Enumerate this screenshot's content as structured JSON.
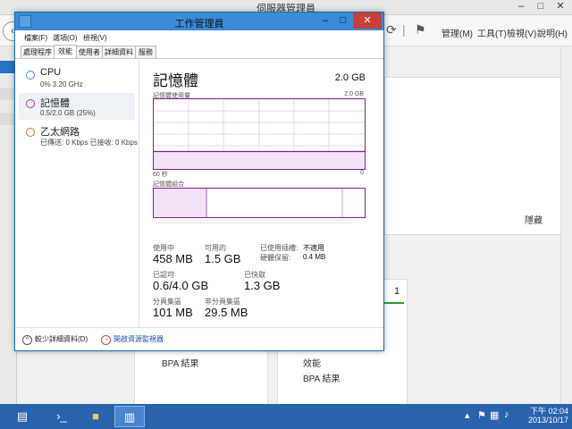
{
  "server_manager": {
    "title": "伺服器管理員",
    "menu": {
      "manage": "管理(M)",
      "tools": "工具(T)",
      "view": "檢視(V)",
      "help": "說明(H)"
    },
    "hide_label": "隱藏",
    "tile_count": "1",
    "bpa_left": "BPA 結果",
    "performance": "效能",
    "bpa_right": "BPA 結果"
  },
  "task_manager": {
    "title": "工作管理員",
    "menu": [
      "檔案(F)",
      "選項(O)",
      "檢視(V)"
    ],
    "tabs": [
      "處理程序",
      "效能",
      "使用者",
      "詳細資料",
      "服務"
    ],
    "active_tab": "效能",
    "resources": [
      {
        "name": "CPU",
        "sub": "0% 3.20 GHz",
        "ring_color": "#4a8fd0"
      },
      {
        "name": "記憶體",
        "sub": "0.5/2.0 GB (25%)",
        "ring_color": "#9b3fb0",
        "selected": true
      },
      {
        "name": "乙太網路",
        "sub": "已傳送: 0 Kbps 已接收: 0 Kbps",
        "ring_color": "#c87a2a"
      }
    ],
    "memory": {
      "title": "記憶體",
      "total": "2.0 GB",
      "usage_label": "記憶體使用量",
      "usage_max": "2.0 GB",
      "time_start": "60 秒",
      "time_end": "0",
      "composition_label": "記憶體組合",
      "in_use_fraction": 0.25,
      "stats": {
        "in_use_label": "使用中",
        "in_use_value": "458 MB",
        "available_label": "可用的",
        "available_value": "1.5 GB",
        "committed_label": "已認可",
        "committed_value": "0.6/4.0 GB",
        "cached_label": "已快取",
        "cached_value": "1.3 GB",
        "paged_label": "分頁集區",
        "paged_value": "101 MB",
        "nonpaged_label": "非分頁集區",
        "nonpaged_value": "29.5 MB",
        "slots_label": "已使用插槽:",
        "slots_value": "不適用",
        "hw_reserved_label": "硬體保留:",
        "hw_reserved_value": "0.4 MB"
      }
    },
    "footer": {
      "fewer_details": "較少詳細資料(D)",
      "open_resmon": "開啟資源監視器"
    },
    "colors": {
      "accent": "#8b1a9b",
      "titlebar": "#3b8bd8",
      "close": "#c7413a"
    }
  },
  "taskbar": {
    "time": "下午 02:04",
    "date": "2013/10/17"
  }
}
